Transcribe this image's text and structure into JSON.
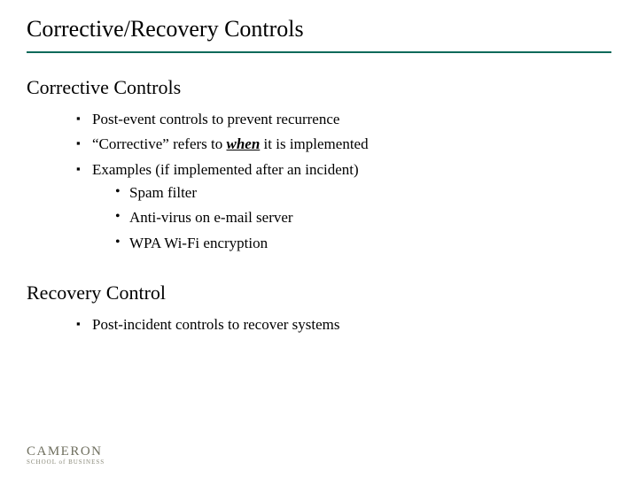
{
  "title": "Corrective/Recovery Controls",
  "sections": [
    {
      "heading": "Corrective Controls",
      "bullets": [
        {
          "text": "Post-event controls to prevent recurrence"
        },
        {
          "prefix": "“Corrective” refers to ",
          "emph": "when",
          "suffix": " it is implemented"
        },
        {
          "text": "Examples (if implemented after an incident)",
          "sub": [
            "Spam filter",
            "Anti-virus on e-mail server",
            "WPA Wi-Fi encryption"
          ]
        }
      ]
    },
    {
      "heading": "Recovery Control",
      "bullets": [
        {
          "text": "Post-incident controls to recover systems"
        }
      ]
    }
  ],
  "logo": {
    "line1": "CAMERON",
    "line2": "SCHOOL of BUSINESS"
  }
}
